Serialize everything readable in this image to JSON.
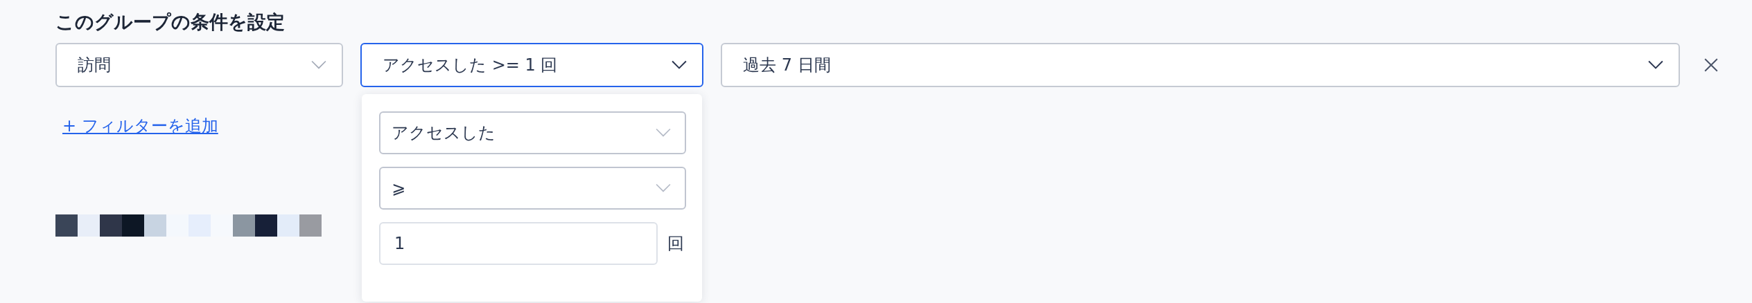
{
  "heading": "このグループの条件を設定",
  "filter": {
    "event": {
      "value": "訪問"
    },
    "condition": {
      "value": "アクセスした >= 1 回",
      "expanded": true
    },
    "period": {
      "value": "過去 7 日間"
    }
  },
  "add_filter_link": "+ フィルターを追加",
  "condition_panel": {
    "action": {
      "value": "アクセスした"
    },
    "operator": {
      "value": "⩾"
    },
    "count": {
      "value": "1"
    },
    "unit": "回"
  }
}
